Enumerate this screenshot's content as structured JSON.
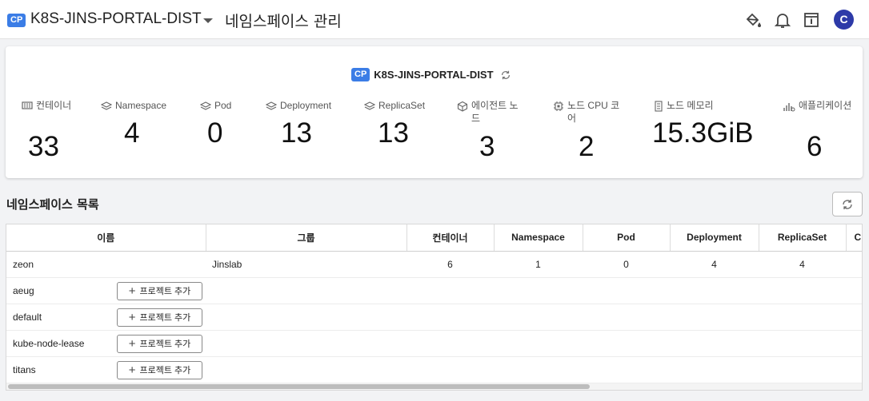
{
  "header": {
    "badge": "CP",
    "cluster": "K8S-JINS-PORTAL-DIST",
    "title": "네임스페이스 관리",
    "avatar": "C"
  },
  "summary": {
    "badge": "CP",
    "cluster": "K8S-JINS-PORTAL-DIST",
    "stats": [
      {
        "label": "컨테이너",
        "value": "33",
        "icon": "container-icon"
      },
      {
        "label": "Namespace",
        "value": "4",
        "icon": "layers-icon"
      },
      {
        "label": "Pod",
        "value": "0",
        "icon": "layers-icon"
      },
      {
        "label": "Deployment",
        "value": "13",
        "icon": "layers-icon"
      },
      {
        "label": "ReplicaSet",
        "value": "13",
        "icon": "layers-icon"
      },
      {
        "label": "에이전트 노드",
        "value": "3",
        "icon": "cube-icon"
      },
      {
        "label": "노드 CPU 코어",
        "value": "2",
        "icon": "cpu-icon"
      },
      {
        "label": "노드 메모리",
        "value": "15.3GiB",
        "icon": "memory-icon"
      },
      {
        "label": "애플리케이션",
        "value": "6",
        "icon": "app-icon"
      }
    ]
  },
  "section": {
    "title": "네임스페이스 목록"
  },
  "table": {
    "columns": [
      "이름",
      "그룹",
      "컨테이너",
      "Namespace",
      "Pod",
      "Deployment",
      "ReplicaSet",
      "C"
    ],
    "add_label": "프로젝트 추가",
    "rows": [
      {
        "name": "zeon",
        "group": "Jinslab",
        "values": [
          "6",
          "1",
          "0",
          "4",
          "4",
          ""
        ]
      },
      {
        "name": "aeug"
      },
      {
        "name": "default"
      },
      {
        "name": "kube-node-lease"
      },
      {
        "name": "titans"
      }
    ]
  },
  "colors": {
    "accent": "#3b7de6",
    "avatar": "#2d3aa8"
  }
}
